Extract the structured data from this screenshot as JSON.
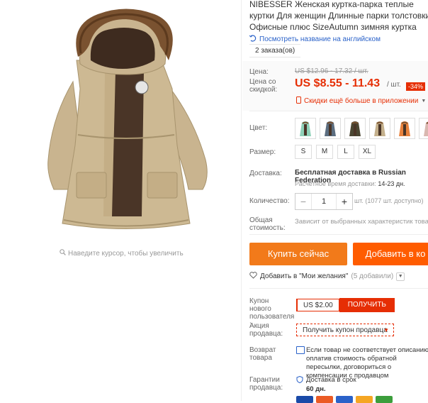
{
  "product": {
    "title": "NIBESSER Женская куртка-парка теплые куртки Для женщин Длинные парки толстовки Офисные плюс SizeAutumn зимняя куртка",
    "translate_link": "Посмотреть название на английском",
    "orders": "2 заказа(ов)",
    "zoom_hint": "Наведите курсор, чтобы увеличить"
  },
  "price": {
    "label": "Цена:",
    "old": "US $12.96 - 17.32 / шт.",
    "discount_label": "Цена со скидкой:",
    "new": "US $8.55 - 11.43",
    "unit": "/ шт.",
    "badge": "-34%",
    "more_discounts": "Скидки ещё больше в приложении"
  },
  "color": {
    "label": "Цвет:",
    "swatches": [
      "mint",
      "blue-gray",
      "army-green",
      "khaki",
      "orange",
      "pink"
    ],
    "swatch_colors": [
      "#8fd1b8",
      "#5b6d80",
      "#4a4632",
      "#c4b08c",
      "#e8823c",
      "#d9b8b0"
    ]
  },
  "size": {
    "label": "Размер:",
    "options": [
      "S",
      "M",
      "L",
      "XL"
    ]
  },
  "shipping": {
    "label": "Доставка:",
    "line": "Бесплатная доставка в Russian Federation",
    "eta_prefix": "Расчётное время доставки:",
    "eta": "14-23 дн."
  },
  "quantity": {
    "label": "Количество:",
    "value": "1",
    "note": "шт. (1077 шт. доступно)"
  },
  "total": {
    "label": "Общая стоимость:",
    "value": "Зависит от выбранных характеристик това"
  },
  "actions": {
    "buy": "Купить сейчас",
    "cart": "Добавить в ко",
    "wish": "Добавить в \"Мои желания\"",
    "wish_count": "(5 добавили)"
  },
  "coupons": {
    "new_user_label": "Купон нового пользователя :",
    "new_user_value": "US $2.00",
    "get": "ПОЛУЧИТЬ",
    "seller_label": "Акция продавца:",
    "seller_btn": "Получить купон продавца"
  },
  "returns": {
    "label": "Возврат товара",
    "text": "Если товар не соответствует описанию, оплатив стоимость обратной пересылки, договориться о компенсации с продавцом"
  },
  "guarantee": {
    "label": "Гарантии продавца:",
    "line1": "Доставка в срок",
    "line2": "60 дн."
  },
  "colors": {
    "accent": "#e62e04",
    "buy_button": "#f27a1a",
    "cart_button": "#ff5c00",
    "link": "#2a62c9"
  }
}
